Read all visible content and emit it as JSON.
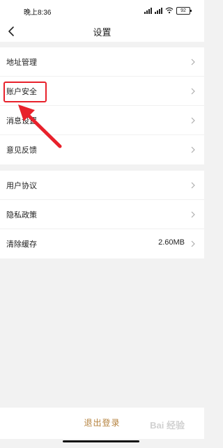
{
  "status_bar": {
    "time": "晚上8:36",
    "battery": "92"
  },
  "nav": {
    "title": "设置"
  },
  "group1": [
    {
      "label": "地址管理"
    },
    {
      "label": "账户安全"
    },
    {
      "label": "消息设置"
    },
    {
      "label": "意见反馈"
    }
  ],
  "group2": [
    {
      "label": "用户协议"
    },
    {
      "label": "隐私政策"
    },
    {
      "label": "清除缓存",
      "value": "2.60MB"
    }
  ],
  "footer": {
    "logout_label": "退出登录"
  },
  "watermark": "Bai 经验",
  "colors": {
    "highlight": "#e8212b",
    "logout_text": "#b5823e"
  }
}
